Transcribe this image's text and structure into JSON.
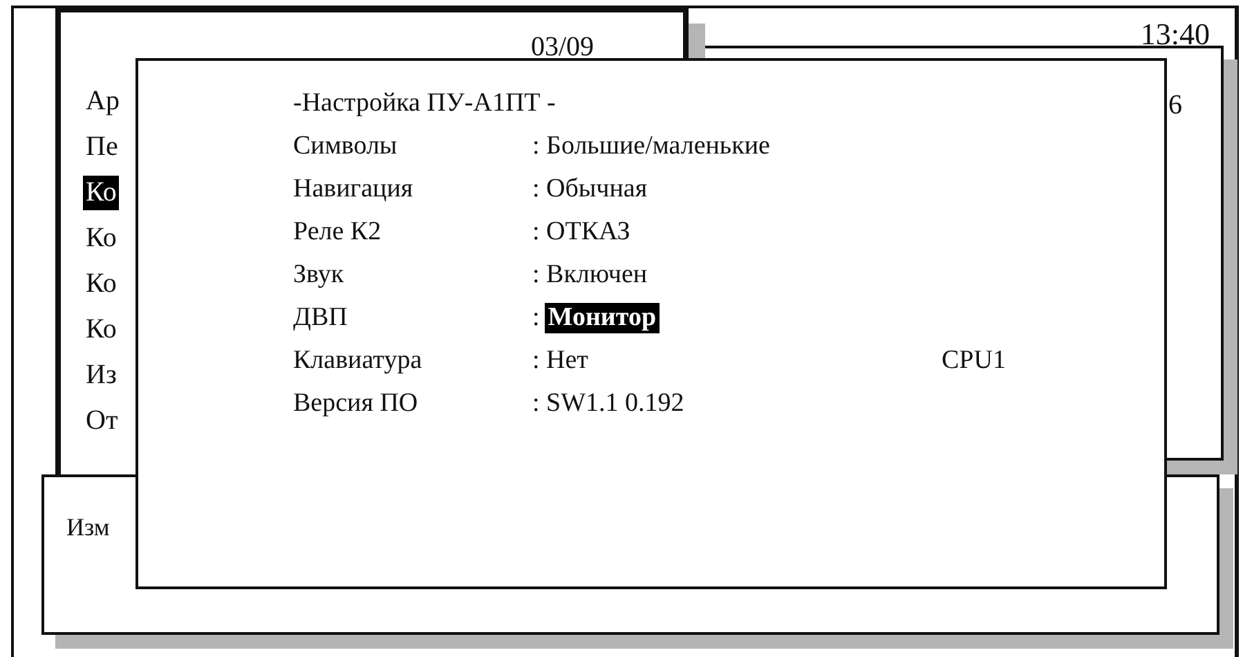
{
  "status_window": {
    "time": "13:40"
  },
  "back_window": {
    "text": "6"
  },
  "menu_window": {
    "date": "03/09",
    "items": [
      {
        "label": "Ар",
        "selected": false
      },
      {
        "label": "Пе",
        "selected": false
      },
      {
        "label": "Ко",
        "selected": true
      },
      {
        "label": "Ко",
        "selected": false
      },
      {
        "label": "Ко",
        "selected": false
      },
      {
        "label": "Ко",
        "selected": false
      },
      {
        "label": "Из",
        "selected": false
      },
      {
        "label": "От",
        "selected": false
      }
    ]
  },
  "bottom_window": {
    "text": "Изм"
  },
  "settings_dialog": {
    "title": "-Настройка ПУ-А1ПТ -",
    "rows": [
      {
        "label": "Символы",
        "value": ": Большие/маленькие",
        "selected": false
      },
      {
        "label": "Навигация",
        "value": ": Обычная",
        "selected": false
      },
      {
        "label": "Реле К2",
        "value": ": ОТКАЗ",
        "selected": false
      },
      {
        "label": "Звук",
        "value": ": Включен",
        "selected": false
      },
      {
        "label": "ДВП",
        "separator": ":",
        "value": "Монитор",
        "selected": true
      },
      {
        "label": "Клавиатура",
        "value": ": Нет",
        "note": "CPU1",
        "selected": false
      },
      {
        "label": "Версия ПО",
        "value": ": SW1.1 0.192",
        "selected": false
      }
    ]
  }
}
